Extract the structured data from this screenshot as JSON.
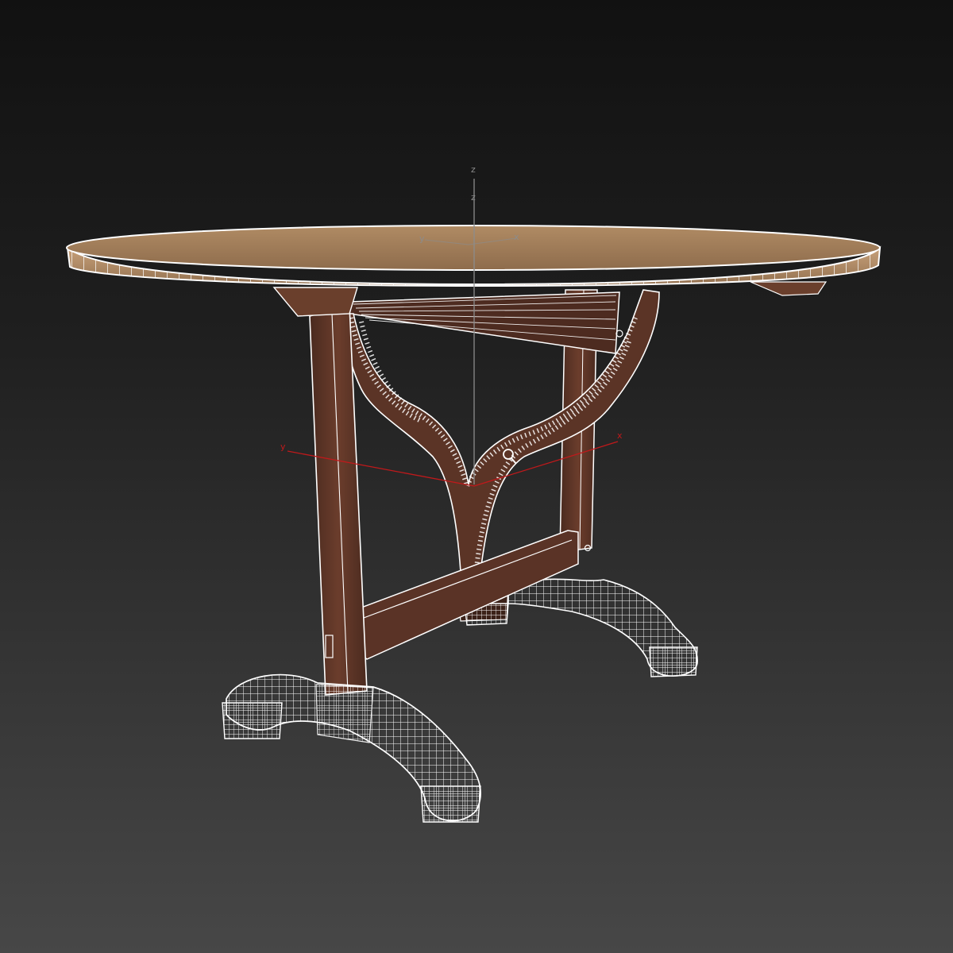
{
  "viewport": {
    "background_top": "#111111",
    "background_bottom": "#474747"
  },
  "model": {
    "top_color": "#a6835e",
    "wood_dark": "#5a3326",
    "wire_color": "#ffffff"
  },
  "axes": {
    "z_label": "z",
    "z_pivot_label": "z",
    "y_label": "y",
    "x_label": "x",
    "top_y_label": "y",
    "top_x_label": "x",
    "world_axis_color": "#c0191b",
    "vertical_axis_color": "#8c8c8c"
  },
  "gizmos": {
    "pivot_icon": "magnifier-icon"
  }
}
